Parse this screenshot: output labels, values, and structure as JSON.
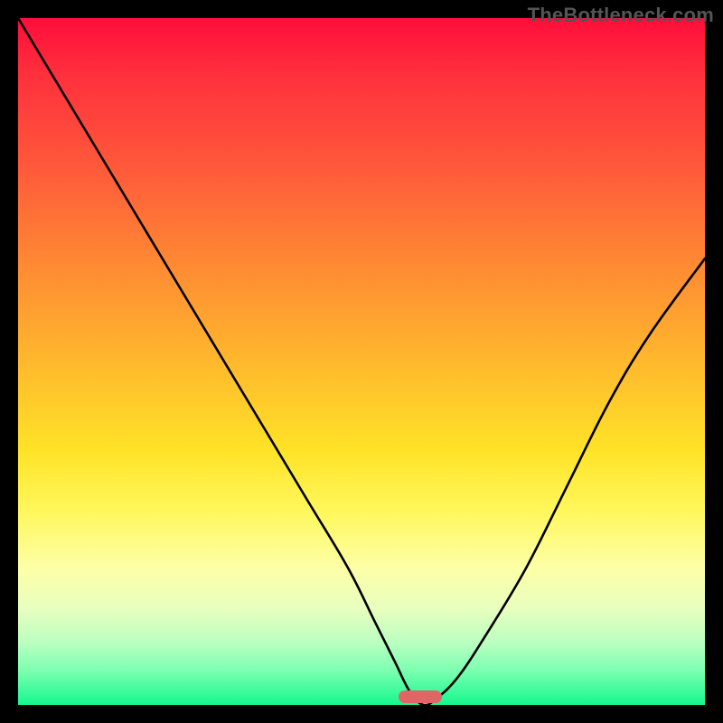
{
  "watermark": "TheBottleneck.com",
  "chart_data": {
    "type": "line",
    "title": "",
    "xlabel": "",
    "ylabel": "",
    "xlim": [
      0,
      100
    ],
    "ylim": [
      0,
      100
    ],
    "grid": false,
    "legend": false,
    "series": [
      {
        "name": "bottleneck-curve",
        "x": [
          0,
          6,
          12,
          18,
          24,
          30,
          36,
          42,
          48,
          52,
          55,
          57,
          59,
          61,
          64,
          68,
          74,
          80,
          86,
          92,
          100
        ],
        "y": [
          100,
          90,
          80,
          70,
          60,
          50,
          40,
          30,
          20,
          12,
          6,
          2,
          0,
          1,
          4,
          10,
          20,
          32,
          44,
          54,
          65
        ]
      }
    ],
    "marker": {
      "x": 58.5,
      "y": 1.2,
      "color": "#e06666"
    },
    "background_gradient": {
      "direction": "vertical",
      "stops": [
        {
          "pos": 0.0,
          "color": "#ff0d3a"
        },
        {
          "pos": 0.5,
          "color": "#ffb82d"
        },
        {
          "pos": 0.8,
          "color": "#fdffa6"
        },
        {
          "pos": 1.0,
          "color": "#14f78e"
        }
      ]
    }
  }
}
